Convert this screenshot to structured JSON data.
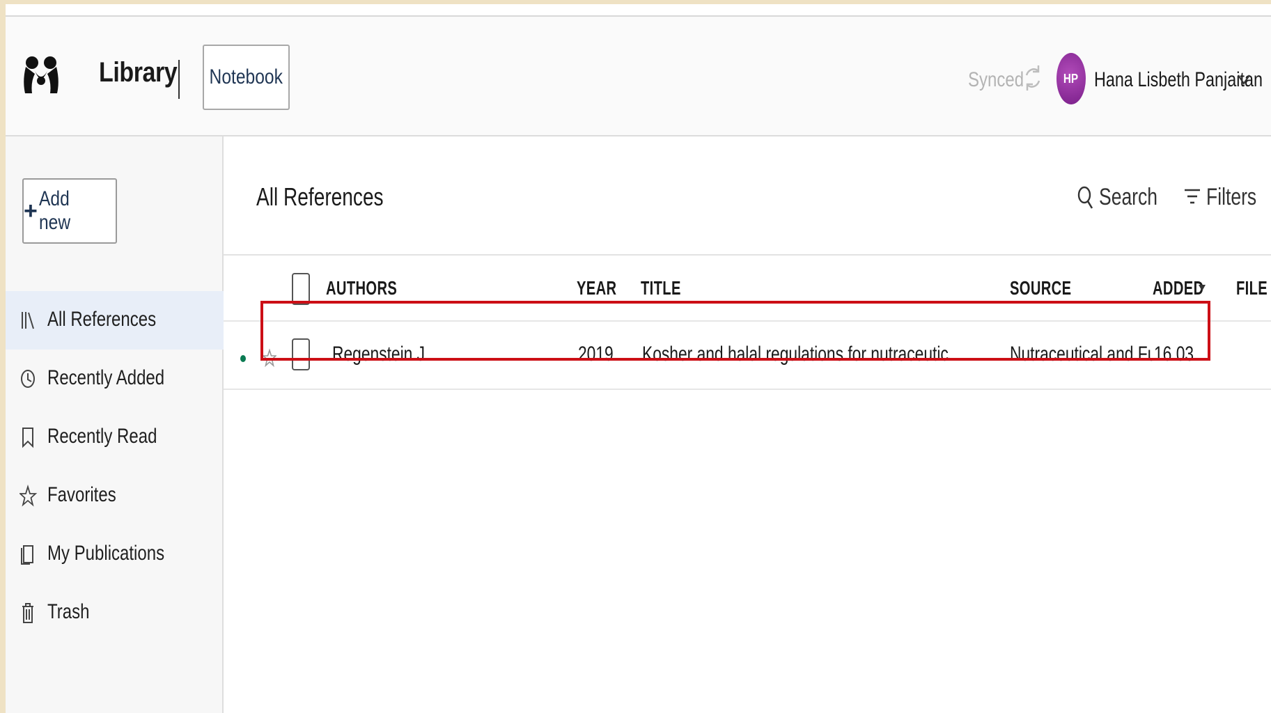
{
  "header": {
    "brand": "Library",
    "notebook_label": "Notebook",
    "sync_status": "Synced",
    "user": {
      "initials": "HP",
      "name": "Hana Lisbeth Panjaitan"
    }
  },
  "sidebar": {
    "add_new_plus": "+",
    "add_new_label": "Add new",
    "items": [
      {
        "label": "All References",
        "icon": "library-icon",
        "active": true
      },
      {
        "label": "Recently Added",
        "icon": "clock-icon",
        "active": false
      },
      {
        "label": "Recently Read",
        "icon": "bookmark-icon",
        "active": false
      },
      {
        "label": "Favorites",
        "icon": "star-icon",
        "active": false
      },
      {
        "label": "My Publications",
        "icon": "publications-icon",
        "active": false
      },
      {
        "label": "Trash",
        "icon": "trash-icon",
        "active": false
      }
    ]
  },
  "main": {
    "title": "All References",
    "search_label": "Search",
    "filters_label": "Filters",
    "columns": {
      "authors": "AUTHORS",
      "year": "YEAR",
      "title": "TITLE",
      "source": "SOURCE",
      "added": "ADDED",
      "file": "FILE"
    },
    "rows": [
      {
        "authors": "Regenstein J",
        "year": "2019",
        "title": "Kosher and halal regulations for nutraceutical and functional f",
        "source": "Nutraceutical and Fun",
        "added": "16.03",
        "unread": true
      }
    ]
  },
  "colors": {
    "accent": "#1f3553",
    "avatar": "#8e2b9c",
    "unread_dot": "#0a7a52",
    "highlight_box": "#cc0f16",
    "active_nav_bg": "#e8eef8"
  }
}
